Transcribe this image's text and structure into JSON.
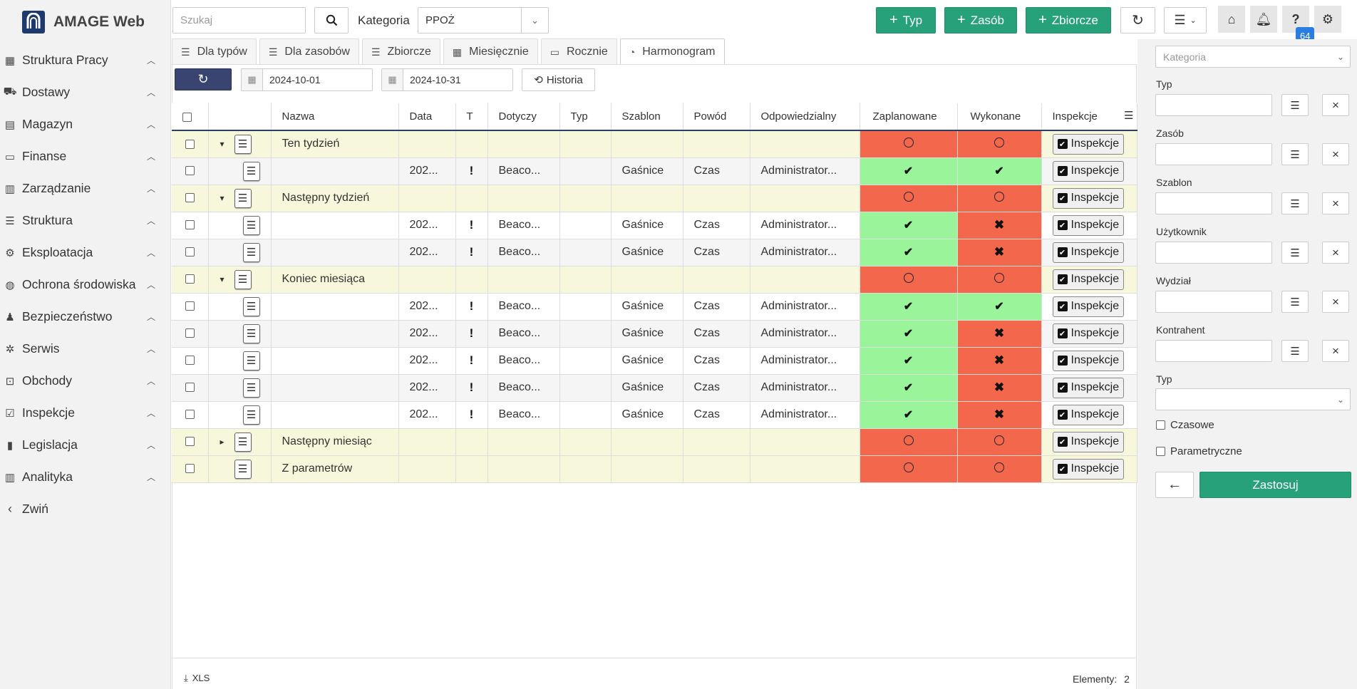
{
  "app": {
    "title": "AMAGE Web"
  },
  "sidebar": {
    "items": [
      {
        "icon": "sitemap-icon",
        "glyph": "▦",
        "label": "Struktura Pracy"
      },
      {
        "icon": "truck-icon",
        "glyph": "⛟",
        "label": "Dostawy"
      },
      {
        "icon": "warehouse-icon",
        "glyph": "▤",
        "label": "Magazyn"
      },
      {
        "icon": "money-icon",
        "glyph": "▭",
        "label": "Finanse"
      },
      {
        "icon": "building-icon",
        "glyph": "▥",
        "label": "Zarządzanie"
      },
      {
        "icon": "structure-icon",
        "glyph": "☰",
        "label": "Struktura"
      },
      {
        "icon": "exploitation-icon",
        "glyph": "⚙",
        "label": "Eksploatacja"
      },
      {
        "icon": "globe-icon",
        "glyph": "◍",
        "label": "Ochrona środowiska"
      },
      {
        "icon": "user-shield-icon",
        "glyph": "♟",
        "label": "Bezpieczeństwo"
      },
      {
        "icon": "bug-icon",
        "glyph": "✲",
        "label": "Serwis"
      },
      {
        "icon": "route-icon",
        "glyph": "⊡",
        "label": "Obchody"
      },
      {
        "icon": "check-square-icon",
        "glyph": "☑",
        "label": "Inspekcje"
      },
      {
        "icon": "book-icon",
        "glyph": "▮",
        "label": "Legislacja"
      },
      {
        "icon": "chart-icon",
        "glyph": "▥",
        "label": "Analityka"
      }
    ],
    "collapse_label": "Zwiń"
  },
  "toolbar": {
    "search_placeholder": "Szukaj",
    "category_label": "Kategoria",
    "category_value": "PPOŻ",
    "add_type": "Typ",
    "add_resource": "Zasób",
    "add_collective": "Zbiorcze",
    "badge_count": "64"
  },
  "tabs": [
    {
      "icon": "list-icon",
      "glyph": "☰",
      "label": "Dla typów"
    },
    {
      "icon": "list-icon",
      "glyph": "☰",
      "label": "Dla zasobów"
    },
    {
      "icon": "list-icon",
      "glyph": "☰",
      "label": "Zbiorcze"
    },
    {
      "icon": "calendar-grid-icon",
      "glyph": "▦",
      "label": "Miesięcznie"
    },
    {
      "icon": "calendar-icon",
      "glyph": "▭",
      "label": "Rocznie"
    },
    {
      "icon": "calendar-clock-icon",
      "glyph": "◔",
      "label": "Harmonogram"
    }
  ],
  "filters": {
    "date_from": "2024-10-01",
    "date_to": "2024-10-31",
    "history_label": "Historia"
  },
  "table": {
    "columns": [
      "Nazwa",
      "Data",
      "T",
      "Dotyczy",
      "Typ",
      "Szablon",
      "Powód",
      "Odpowiedzialny",
      "Zaplanowane",
      "Wykonane",
      "Inspekcje"
    ],
    "inspect_label": "Inspekcje",
    "rows": [
      {
        "kind": "group",
        "expander": "▾",
        "name": "Ten tydzień",
        "planned": "circle",
        "done": "circle"
      },
      {
        "kind": "row",
        "date": "202...",
        "t": "!",
        "about": "Beaco...",
        "type": "",
        "template": "Gaśnice",
        "reason": "Czas",
        "owner": "Administrator...",
        "planned": "ok",
        "done": "ok"
      },
      {
        "kind": "group",
        "expander": "▾",
        "name": "Następny tydzień",
        "planned": "circle",
        "done": "circle"
      },
      {
        "kind": "row",
        "date": "202...",
        "t": "!",
        "about": "Beaco...",
        "type": "",
        "template": "Gaśnice",
        "reason": "Czas",
        "owner": "Administrator...",
        "planned": "ok",
        "done": "x"
      },
      {
        "kind": "row",
        "date": "202...",
        "t": "!",
        "about": "Beaco...",
        "type": "",
        "template": "Gaśnice",
        "reason": "Czas",
        "owner": "Administrator...",
        "planned": "ok",
        "done": "x"
      },
      {
        "kind": "group",
        "expander": "▾",
        "name": "Koniec miesiąca",
        "planned": "circle",
        "done": "circle"
      },
      {
        "kind": "row",
        "date": "202...",
        "t": "!",
        "about": "Beaco...",
        "type": "",
        "template": "Gaśnice",
        "reason": "Czas",
        "owner": "Administrator...",
        "planned": "ok",
        "done": "ok"
      },
      {
        "kind": "row",
        "date": "202...",
        "t": "!",
        "about": "Beaco...",
        "type": "",
        "template": "Gaśnice",
        "reason": "Czas",
        "owner": "Administrator...",
        "planned": "ok",
        "done": "x"
      },
      {
        "kind": "row",
        "date": "202...",
        "t": "!",
        "about": "Beaco...",
        "type": "",
        "template": "Gaśnice",
        "reason": "Czas",
        "owner": "Administrator...",
        "planned": "ok",
        "done": "x"
      },
      {
        "kind": "row",
        "date": "202...",
        "t": "!",
        "about": "Beaco...",
        "type": "",
        "template": "Gaśnice",
        "reason": "Czas",
        "owner": "Administrator...",
        "planned": "ok",
        "done": "x"
      },
      {
        "kind": "row",
        "date": "202...",
        "t": "!",
        "about": "Beaco...",
        "type": "",
        "template": "Gaśnice",
        "reason": "Czas",
        "owner": "Administrator...",
        "planned": "ok",
        "done": "x"
      },
      {
        "kind": "group",
        "expander": "▸",
        "name": "Następny miesiąc",
        "planned": "circle",
        "done": "circle"
      },
      {
        "kind": "group",
        "expander": "",
        "name": "Z parametrów",
        "planned": "circle",
        "done": "circle"
      }
    ]
  },
  "footer": {
    "export_label": "XLS",
    "count_label": "Elementy:",
    "count_value": "2"
  },
  "right_panel": {
    "category_placeholder": "Kategoria",
    "fields": [
      "Typ",
      "Zasób",
      "Szablon",
      "Użytkownik",
      "Wydział",
      "Kontrahent"
    ],
    "type_label": "Typ",
    "timed_label": "Czasowe",
    "param_label": "Parametryczne",
    "apply_label": "Zastosuj"
  },
  "colors": {
    "accent": "#26a17a",
    "red": "#f3674c",
    "green": "#9af59a",
    "group_bg": "#f7f7dc",
    "dark_blue": "#2c3e64"
  }
}
